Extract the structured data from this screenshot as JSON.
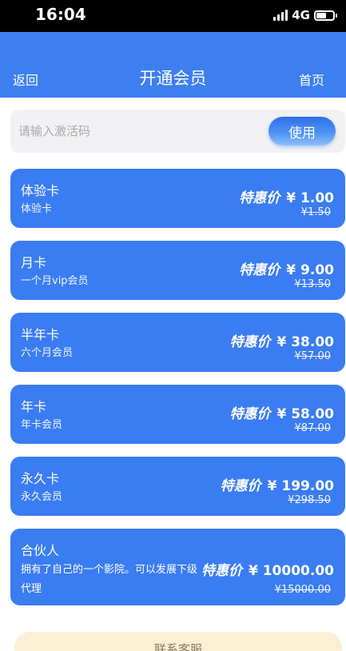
{
  "status": {
    "time": "16:04",
    "network": "4G"
  },
  "header": {
    "back_label": "返回",
    "title": "开通会员",
    "home_label": "首页"
  },
  "activation": {
    "placeholder": "请输入激活码",
    "button_label": "使用"
  },
  "plans": [
    {
      "name": "体验卡",
      "desc": "体验卡",
      "price_label": "特惠价",
      "price": "¥ 1.00",
      "original": "¥1.50"
    },
    {
      "name": "月卡",
      "desc": "一个月vip会员",
      "price_label": "特惠价",
      "price": "¥ 9.00",
      "original": "¥13.50"
    },
    {
      "name": "半年卡",
      "desc": "六个月会员",
      "price_label": "特惠价",
      "price": "¥ 38.00",
      "original": "¥57.00"
    },
    {
      "name": "年卡",
      "desc": "年卡会员",
      "price_label": "特惠价",
      "price": "¥ 58.00",
      "original": "¥87.00"
    },
    {
      "name": "永久卡",
      "desc": "永久会员",
      "price_label": "特惠价",
      "price": "¥ 199.00",
      "original": "¥298.50"
    },
    {
      "name": "合伙人",
      "desc": "拥有了自己的一个影院。可以发展下级代理",
      "price_label": "特惠价",
      "price": "¥ 10000.00",
      "original": "¥15000.00"
    }
  ],
  "contact": {
    "label": "联系客服"
  },
  "colors": {
    "header": "#3d7ef0",
    "card": "#3a7cf1",
    "contact_bg": "#fbf0d6"
  }
}
